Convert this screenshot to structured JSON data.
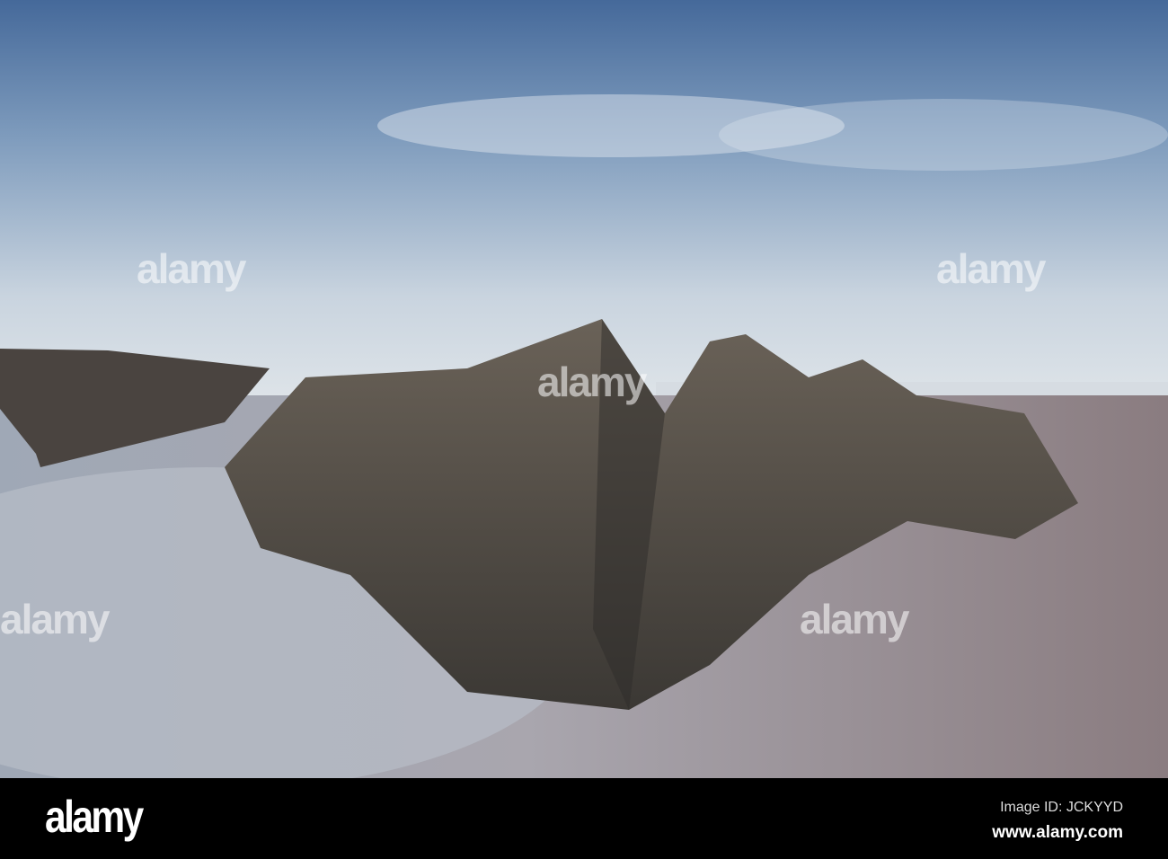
{
  "watermark": {
    "text": "alamy"
  },
  "footer": {
    "logo": "alamy",
    "image_id": "Image ID: JCKYYD",
    "website": "www.alamy.com"
  },
  "colors": {
    "sky_top": "#4a6d9a",
    "sky_horizon": "#d3dbe3",
    "water": "#a9b0bd",
    "sand": "#8f8183",
    "rock": "#4b4640"
  }
}
